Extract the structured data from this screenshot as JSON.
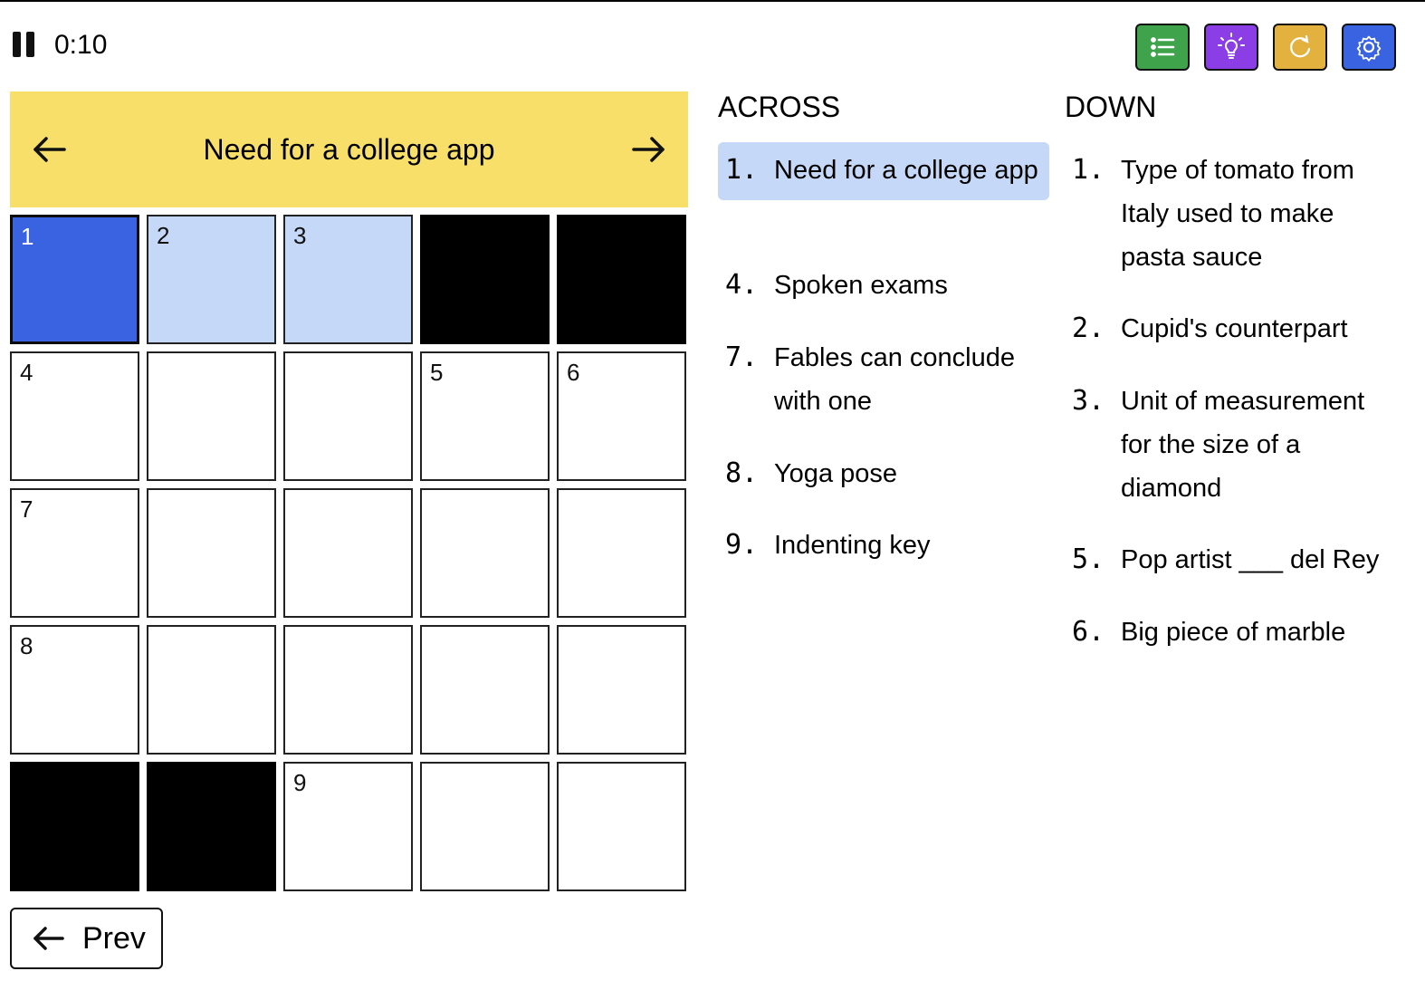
{
  "timer": {
    "value": "0:10"
  },
  "tools": [
    {
      "name": "list",
      "icon": "list-icon",
      "color": "#3ea34b"
    },
    {
      "name": "hint",
      "icon": "lightbulb-icon",
      "color": "#8b3ee6"
    },
    {
      "name": "reset",
      "icon": "refresh-icon",
      "color": "#e3b23e"
    },
    {
      "name": "settings",
      "icon": "gear-icon",
      "color": "#3a63e2"
    }
  ],
  "banner": {
    "clue": "Need for a college app"
  },
  "colors": {
    "banner": "#f8df69",
    "active_cell": "#3a63e2",
    "word_cell": "#c5d8f7",
    "selected_clue": "#c5d8f7"
  },
  "grid": [
    [
      {
        "n": "1",
        "s": "active"
      },
      {
        "n": "2",
        "s": "word"
      },
      {
        "n": "3",
        "s": "word"
      },
      {
        "s": "block"
      },
      {
        "s": "block"
      }
    ],
    [
      {
        "n": "4"
      },
      {},
      {},
      {
        "n": "5"
      },
      {
        "n": "6"
      }
    ],
    [
      {
        "n": "7"
      },
      {},
      {},
      {},
      {}
    ],
    [
      {
        "n": "8"
      },
      {},
      {},
      {},
      {}
    ],
    [
      {
        "s": "block"
      },
      {
        "s": "block"
      },
      {
        "n": "9"
      },
      {},
      {}
    ]
  ],
  "prev": {
    "label": "Prev"
  },
  "across": {
    "heading": "ACROSS",
    "clues": [
      {
        "num": "1.",
        "text": "Need for a college app",
        "selected": true
      },
      {
        "num": "4.",
        "text": "Spoken exams"
      },
      {
        "num": "7.",
        "text": "Fables can conclude with one"
      },
      {
        "num": "8.",
        "text": "Yoga pose"
      },
      {
        "num": "9.",
        "text": "Indenting key"
      }
    ]
  },
  "down": {
    "heading": "DOWN",
    "clues": [
      {
        "num": "1.",
        "text": "Type of tomato from Italy used to make pasta sauce"
      },
      {
        "num": "2.",
        "text": "Cupid's counterpart"
      },
      {
        "num": "3.",
        "text": "Unit of measurement for the size of a diamond"
      },
      {
        "num": "5.",
        "text": "Pop artist ___ del Rey"
      },
      {
        "num": "6.",
        "text": "Big piece of marble"
      }
    ]
  }
}
